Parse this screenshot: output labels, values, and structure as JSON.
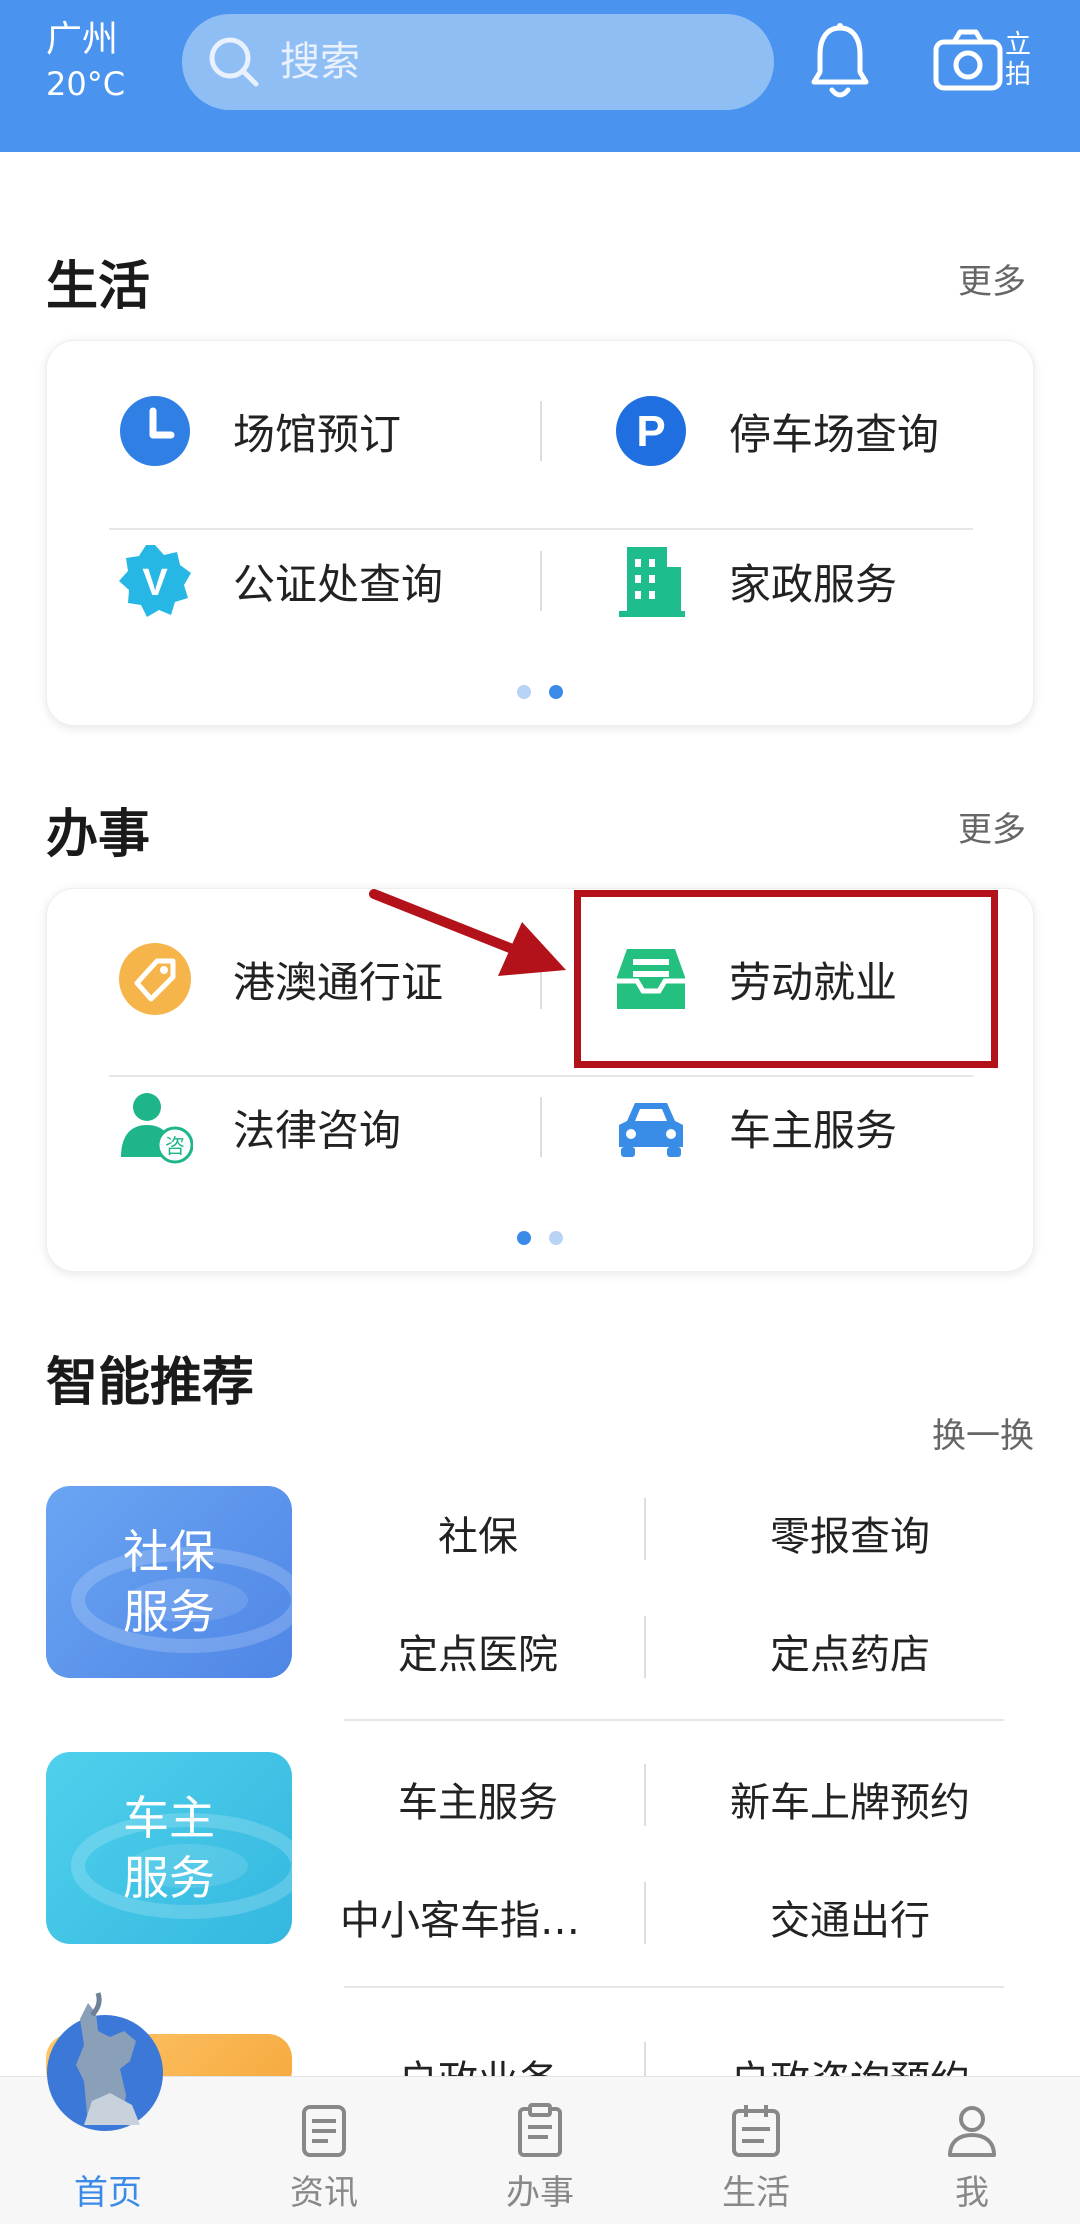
{
  "header": {
    "city": "广州",
    "temperature": "20°C",
    "search_placeholder": "搜索",
    "camera_label": "立拍",
    "bg_color": "#4a94ef"
  },
  "life": {
    "title": "生活",
    "more": "更多",
    "items": [
      {
        "label": "场馆预订",
        "icon": "clock-icon"
      },
      {
        "label": "停车场查询",
        "icon": "parking-icon"
      },
      {
        "label": "公证处查询",
        "icon": "verified-badge-icon"
      },
      {
        "label": "家政服务",
        "icon": "building-icon"
      }
    ]
  },
  "affairs": {
    "title": "办事",
    "more": "更多",
    "items": [
      {
        "label": "港澳通行证",
        "icon": "tag-icon"
      },
      {
        "label": "劳动就业",
        "icon": "inbox-tray-icon"
      },
      {
        "label": "法律咨询",
        "icon": "consultant-icon"
      },
      {
        "label": "车主服务",
        "icon": "car-icon"
      }
    ]
  },
  "recommend": {
    "title": "智能推荐",
    "swap": "换一换",
    "groups": [
      {
        "tile": "社保服务",
        "tile_line1": "社保",
        "tile_line2": "服务",
        "items": [
          "社保",
          "零报查询",
          "定点医院",
          "定点药店"
        ]
      },
      {
        "tile": "车主服务",
        "tile_line1": "车主",
        "tile_line2": "服务",
        "items": [
          "车主服务",
          "新车上牌预约",
          "中小客车指…",
          "交通出行"
        ]
      },
      {
        "items": [
          "户政业务",
          "户政咨询预约"
        ]
      }
    ]
  },
  "nav": {
    "items": [
      {
        "label": "首页",
        "icon": "home-icon",
        "active": true
      },
      {
        "label": "资讯",
        "icon": "news-icon",
        "active": false
      },
      {
        "label": "办事",
        "icon": "clipboard-icon",
        "active": false
      },
      {
        "label": "生活",
        "icon": "calendar-icon",
        "active": false
      },
      {
        "label": "我",
        "icon": "person-icon",
        "active": false
      }
    ],
    "active_color": "#3b8ae8"
  },
  "annotation": {
    "highlight_color": "#b3121b"
  }
}
